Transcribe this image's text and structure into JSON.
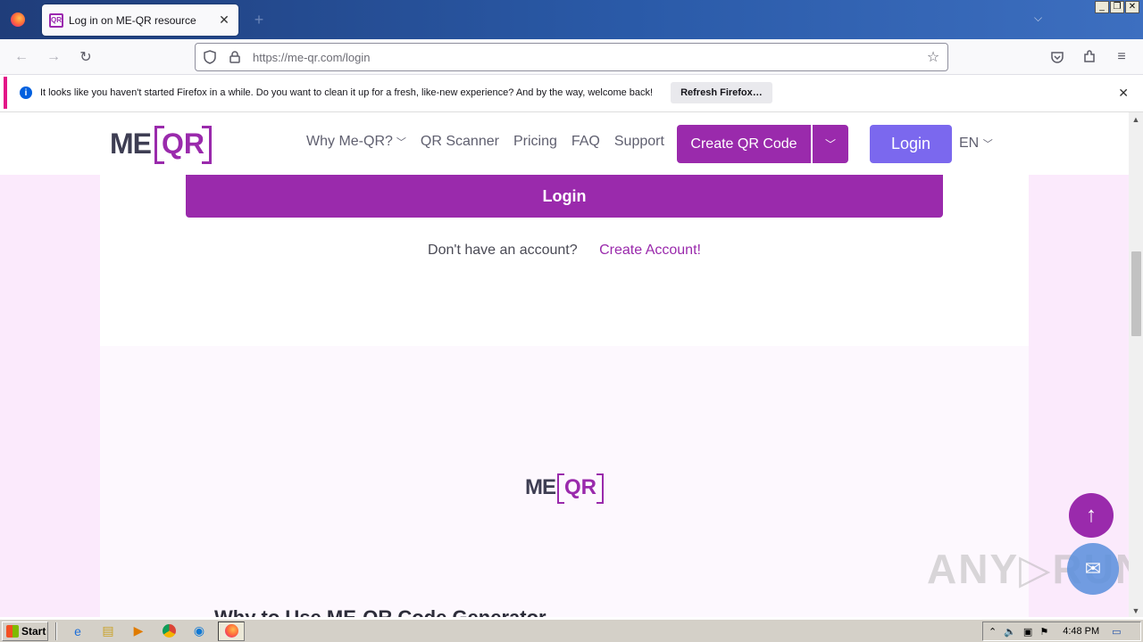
{
  "browser": {
    "tab_title": "Log in on ME-QR resource",
    "tab_favicon_text": "QR",
    "url_host": "https://me-qr.com",
    "url_path": "/login",
    "window_controls": [
      "_",
      "❐",
      "✕"
    ]
  },
  "notification": {
    "text": "It looks like you haven't started Firefox in a while. Do you want to clean it up for a fresh, like-new experience? And by the way, welcome back!",
    "button": "Refresh Firefox…"
  },
  "site": {
    "logo_me": "ME",
    "logo_qr": "QR",
    "menu": [
      {
        "label": "Why Me-QR?",
        "dropdown": true
      },
      {
        "label": "QR Scanner",
        "dropdown": false
      },
      {
        "label": "Pricing",
        "dropdown": false
      },
      {
        "label": "FAQ",
        "dropdown": false
      },
      {
        "label": "Support",
        "dropdown": false
      }
    ],
    "create_button": "Create QR Code",
    "login_button": "Login",
    "language": "EN"
  },
  "login_form": {
    "submit": "Login",
    "no_account": "Don't have an account?",
    "create_account": "Create Account!"
  },
  "footer": {
    "logo_me": "ME",
    "logo_qr": "QR",
    "cut_heading": "Why to Use ME-QR Code Generator"
  },
  "watermark": "ANY▷RUN",
  "taskbar": {
    "start": "Start",
    "time": "4:48 PM"
  },
  "colors": {
    "brand_purple": "#9a2aac",
    "login_violet": "#7b68ee",
    "page_bg": "#fbeafc"
  }
}
